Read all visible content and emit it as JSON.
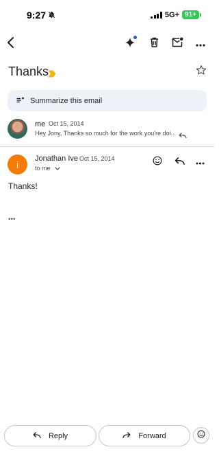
{
  "status_bar": {
    "time": "9:27",
    "network": "5G+",
    "battery": "91+"
  },
  "toolbar": {
    "icons": [
      "back-arrow-icon",
      "gemini-sparkle-icon",
      "trash-icon",
      "mark-unread-icon",
      "more-vertical-icon"
    ]
  },
  "email": {
    "subject": "Thanks",
    "label_color": "#f4b400",
    "summarize_label": "Summarize this email"
  },
  "thread": {
    "collapsed_message": {
      "sender": "me",
      "date": "Oct 15, 2014",
      "snippet": "Hey Jony, Thanks so much for the work you're doi..."
    },
    "expanded_message": {
      "avatar_letter": "i",
      "avatar_color": "#f57c00",
      "sender": "Jonathan Ive",
      "date": "Oct 15, 2014",
      "recipient": "to me",
      "body": "Thanks!",
      "trimmed_indicator": "•••"
    }
  },
  "actions": {
    "reply_label": "Reply",
    "forward_label": "Forward"
  }
}
